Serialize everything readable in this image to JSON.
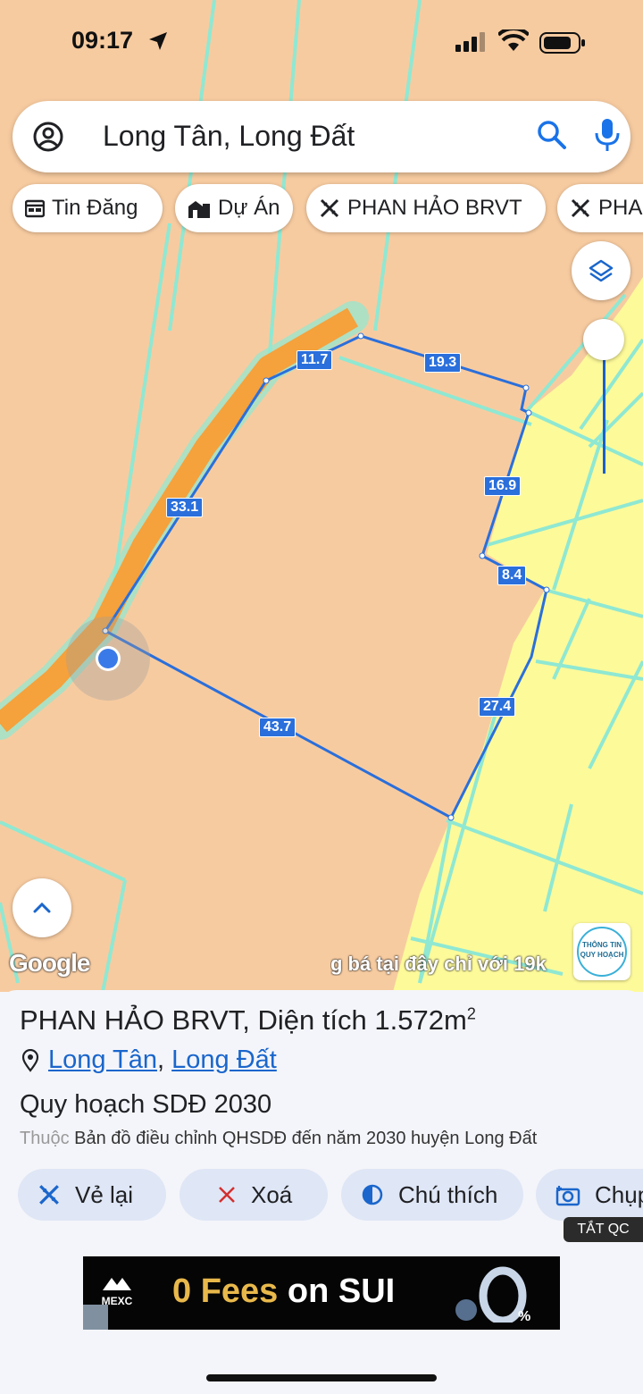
{
  "status_bar": {
    "time": "09:17"
  },
  "search": {
    "query": "Long Tân, Long Đất"
  },
  "chips": [
    {
      "label": "Tin Đăng",
      "icon": "calendar-icon"
    },
    {
      "label": "Dự Án",
      "icon": "building-icon"
    },
    {
      "label": "PHAN HẢO BRVT",
      "icon": "pencil-ruler-icon"
    },
    {
      "label": "PHA",
      "icon": "pencil-ruler-icon"
    }
  ],
  "map": {
    "colors": {
      "land": "#f7cba0",
      "residential": "#fdfa9a",
      "road": "#f5a13c",
      "boundary": "#8fe8d2",
      "plot_outline": "#2a6fdb"
    },
    "edge_labels": [
      "11.7",
      "19.3",
      "33.1",
      "16.9",
      "8.4",
      "27.4",
      "43.7"
    ],
    "google_logo": "Google",
    "ad_ticker": "g bá tại đây chỉ với 19k",
    "badge": {
      "line1": "THÔNG TIN",
      "line2": "QUY HOẠCH"
    }
  },
  "sheet": {
    "owner": "PHAN HẢO BRVT",
    "area_label": "Diện tích 1.572m",
    "area_unit_sup": "2",
    "ward": "Long Tân",
    "district": "Long Đất",
    "plan_title": "Quy hoạch SDĐ 2030",
    "source_prefix": "Thuộc",
    "source": "Bản đồ điều chỉnh QHSDĐ đến năm 2030 huyện Long Đất",
    "actions": [
      {
        "label": "Vẻ lại",
        "icon": "pencil-ruler-icon"
      },
      {
        "label": "Xoá",
        "icon": "close-icon"
      },
      {
        "label": "Chú thích",
        "icon": "contrast-icon"
      },
      {
        "label": "Chụp",
        "icon": "camera-icon"
      }
    ]
  },
  "ad": {
    "hide_label": "TẮT QC",
    "brand": "MEXC",
    "headline_part1": "0 Fees",
    "headline_part2": "on SUI",
    "percent": "0%"
  }
}
